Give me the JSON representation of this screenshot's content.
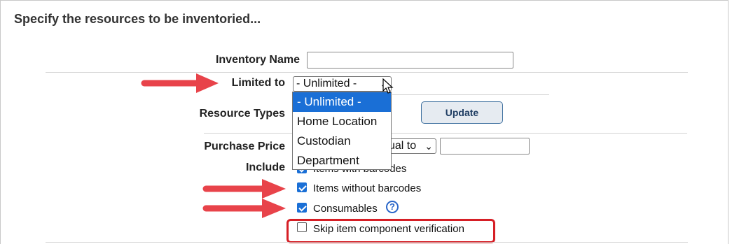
{
  "title": "Specify the resources to be inventoried...",
  "fields": {
    "inventory_name_label": "Inventory Name",
    "inventory_name_value": "",
    "limited_to_label": "Limited to",
    "limited_to_value": "- Unlimited -",
    "resource_types_label": "Resource Types",
    "purchase_price_label": "Purchase Price",
    "purchase_price_operator": "ual to",
    "purchase_price_value": "",
    "include_label": "Include"
  },
  "dropdown": {
    "options": [
      "- Unlimited -",
      "Home Location",
      "Custodian",
      "Department"
    ],
    "selected": "- Unlimited -"
  },
  "update_button": "Update",
  "checkboxes": [
    {
      "label": "Items with barcodes",
      "checked": true
    },
    {
      "label": "Items without barcodes",
      "checked": true
    },
    {
      "label": "Consumables",
      "checked": true
    },
    {
      "label": "Skip item component verification",
      "checked": false
    }
  ],
  "icons": {
    "help": "question-circle-icon",
    "cursor": "mouse-pointer-icon",
    "annotation": "red-arrow-icon"
  },
  "colors": {
    "accent": "#1a6fd6",
    "annotation_red": "#e8434a",
    "highlight_border": "#d61f26",
    "button_border": "#3c6e9e"
  }
}
